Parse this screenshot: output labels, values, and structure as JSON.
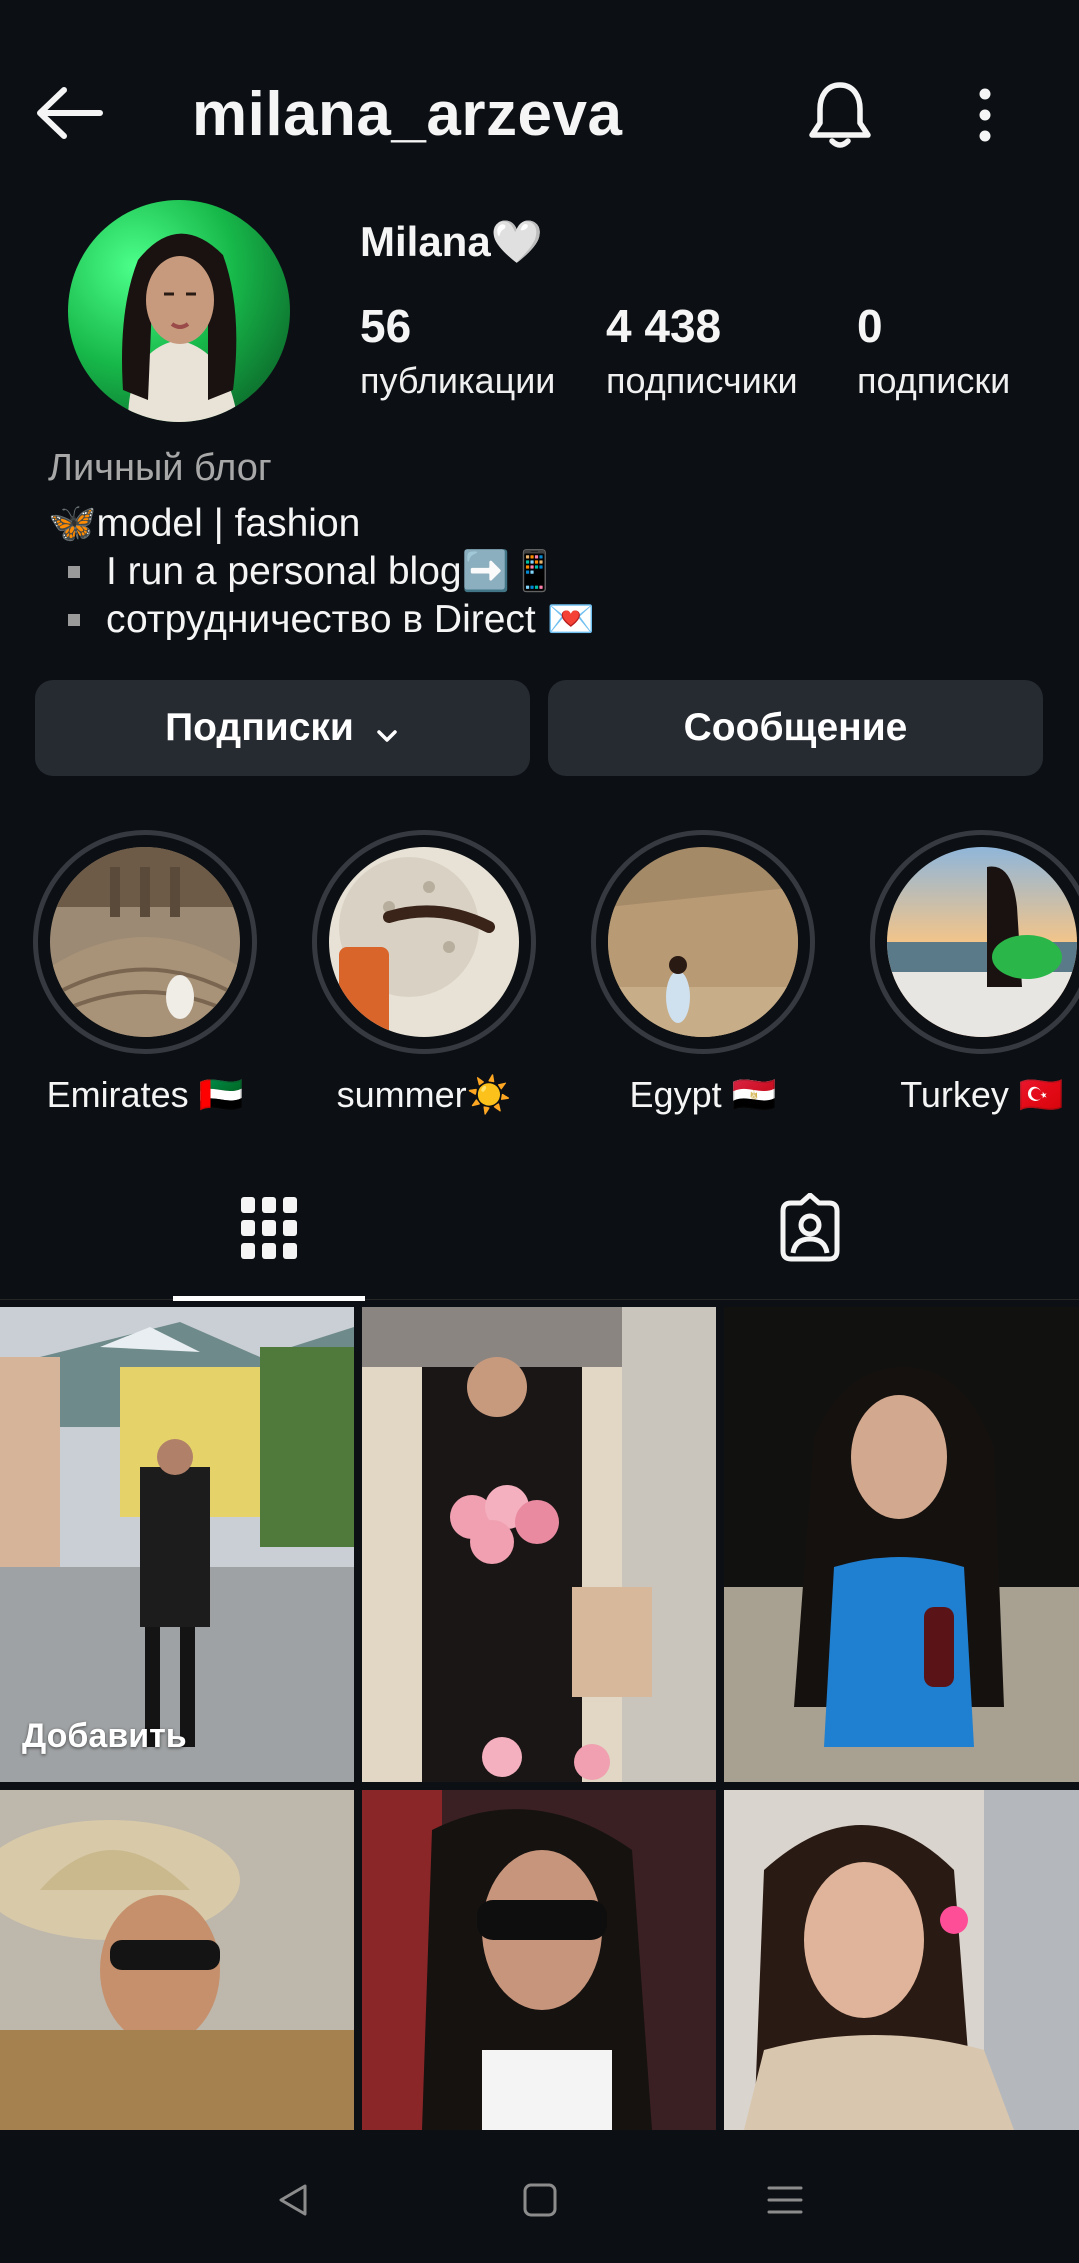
{
  "header": {
    "username": "milana_arzeva"
  },
  "profile": {
    "display_name": "Milana🤍",
    "stats": [
      {
        "value": "56",
        "label": "публикации"
      },
      {
        "value": "4 438",
        "label": "подписчики"
      },
      {
        "value": "0",
        "label": "подписки"
      }
    ],
    "category": "Личный блог",
    "bio_line1": "🦋model | fashion",
    "bio_line2": "I run a personal blog➡️📱",
    "bio_line3": "сотрудничество в Direct 💌"
  },
  "actions": {
    "follow_label": "Подписки",
    "message_label": "Сообщение"
  },
  "highlights": [
    {
      "label": "Emirates 🇦🇪"
    },
    {
      "label": "summer☀️"
    },
    {
      "label": "Egypt 🇪🇬"
    },
    {
      "label": "Turkey 🇹🇷"
    }
  ],
  "grid": {
    "add_label": "Добавить"
  },
  "colors": {
    "background": "#0c1014",
    "button": "#262a31",
    "muted_text": "#a8a8a8"
  },
  "icons": [
    "arrow-left-icon",
    "bell-icon",
    "more-vertical-icon",
    "chevron-down-icon",
    "grid-icon",
    "tagged-person-icon",
    "nav-back-icon",
    "nav-home-icon",
    "nav-menu-icon"
  ]
}
